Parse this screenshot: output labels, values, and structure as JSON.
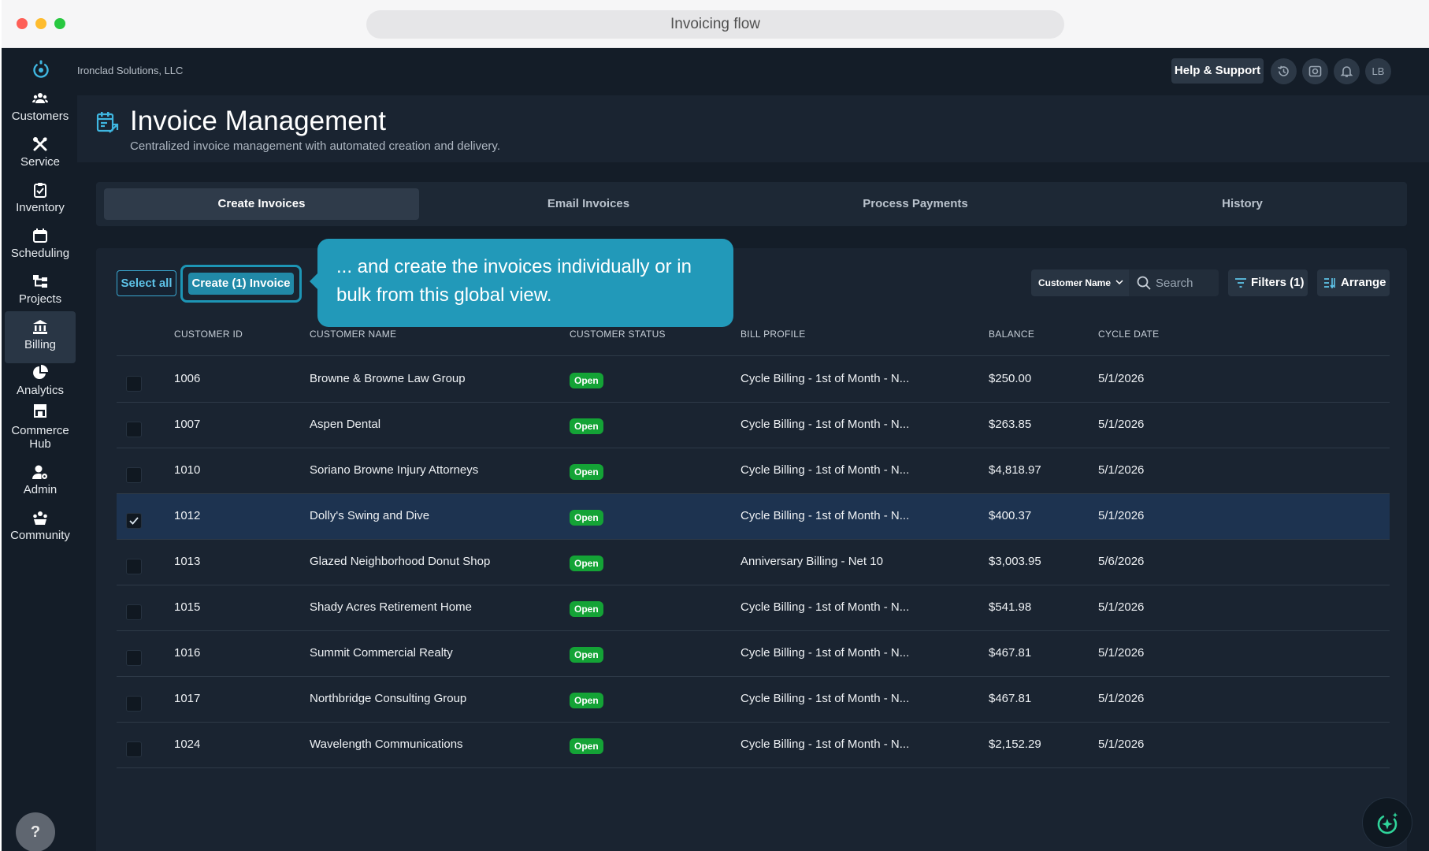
{
  "window": {
    "title": "Invoicing flow"
  },
  "company_name": "Ironclad Solutions, LLC",
  "sidebar": {
    "items": [
      {
        "label": "Customers",
        "icon": "users-icon"
      },
      {
        "label": "Service",
        "icon": "tools-icon"
      },
      {
        "label": "Inventory",
        "icon": "clipboard-icon"
      },
      {
        "label": "Scheduling",
        "icon": "calendar-icon"
      },
      {
        "label": "Projects",
        "icon": "project-tree-icon"
      },
      {
        "label": "Billing",
        "icon": "bank-icon",
        "active": true
      },
      {
        "label": "Analytics",
        "icon": "pie-chart-icon"
      },
      {
        "label": "Commerce Hub",
        "icon": "store-icon"
      },
      {
        "label": "Admin",
        "icon": "user-gear-icon"
      },
      {
        "label": "Community",
        "icon": "community-icon"
      }
    ],
    "help_label": "?"
  },
  "topbar": {
    "help_label": "Help & Support",
    "avatar_initials": "LB"
  },
  "header": {
    "title": "Invoice Management",
    "subtitle": "Centralized invoice management with automated creation and delivery."
  },
  "tabs": [
    {
      "label": "Create Invoices",
      "active": true
    },
    {
      "label": "Email Invoices"
    },
    {
      "label": "Process Payments"
    },
    {
      "label": "History"
    }
  ],
  "toolbar": {
    "select_all_label": "Select all",
    "create_label": "Create (1) Invoice",
    "tooltip_text": "... and create the invoices individually or in bulk from this global view.",
    "sort_field": "Customer Name",
    "search_placeholder": "Search",
    "filters_label": "Filters (1)",
    "arrange_label": "Arrange"
  },
  "table": {
    "columns": [
      "CUSTOMER ID",
      "CUSTOMER NAME",
      "CUSTOMER STATUS",
      "BILL PROFILE",
      "BALANCE",
      "CYCLE DATE"
    ],
    "rows": [
      {
        "id": "1006",
        "name": "Browne & Browne Law Group",
        "status": "Open",
        "profile": "Cycle Billing - 1st of Month - N...",
        "balance": "$250.00",
        "date": "5/1/2026",
        "checked": false
      },
      {
        "id": "1007",
        "name": "Aspen Dental",
        "status": "Open",
        "profile": "Cycle Billing - 1st of Month - N...",
        "balance": "$263.85",
        "date": "5/1/2026",
        "checked": false
      },
      {
        "id": "1010",
        "name": "Soriano Browne Injury Attorneys",
        "status": "Open",
        "profile": "Cycle Billing - 1st of Month - N...",
        "balance": "$4,818.97",
        "date": "5/1/2026",
        "checked": false
      },
      {
        "id": "1012",
        "name": "Dolly's Swing and Dive",
        "status": "Open",
        "profile": "Cycle Billing - 1st of Month - N...",
        "balance": "$400.37",
        "date": "5/1/2026",
        "checked": true
      },
      {
        "id": "1013",
        "name": "Glazed Neighborhood Donut Shop",
        "status": "Open",
        "profile": "Anniversary Billing - Net 10",
        "balance": "$3,003.95",
        "date": "5/6/2026",
        "checked": false
      },
      {
        "id": "1015",
        "name": "Shady Acres Retirement Home",
        "status": "Open",
        "profile": "Cycle Billing - 1st of Month - N...",
        "balance": "$541.98",
        "date": "5/1/2026",
        "checked": false
      },
      {
        "id": "1016",
        "name": "Summit Commercial Realty",
        "status": "Open",
        "profile": "Cycle Billing - 1st of Month - N...",
        "balance": "$467.81",
        "date": "5/1/2026",
        "checked": false
      },
      {
        "id": "1017",
        "name": "Northbridge Consulting Group",
        "status": "Open",
        "profile": "Cycle Billing - 1st of Month - N...",
        "balance": "$467.81",
        "date": "5/1/2026",
        "checked": false
      },
      {
        "id": "1024",
        "name": "Wavelength Communications",
        "status": "Open",
        "profile": "Cycle Billing - 1st of Month - N...",
        "balance": "$2,152.29",
        "date": "5/1/2026",
        "checked": false
      }
    ]
  },
  "colors": {
    "accent": "#2299b9",
    "status_open": "#14a336",
    "background": "#141d28"
  }
}
